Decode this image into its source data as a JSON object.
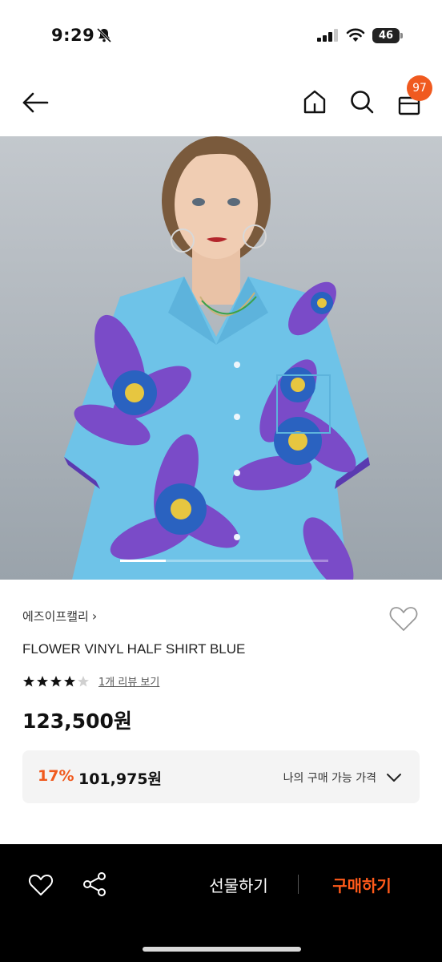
{
  "status_bar": {
    "time": "9:29",
    "battery": "46"
  },
  "header": {
    "cart_count": "97"
  },
  "product": {
    "brand": "에즈이프캘리",
    "name": "FLOWER VINYL HALF SHIRT BLUE",
    "rating": 4,
    "rating_max": 5,
    "review_link": "1개 리뷰 보기",
    "price": "123,500원",
    "image_progress": 0.22
  },
  "my_price": {
    "discount": "17%",
    "price": "101,975원",
    "label": "나의 구매 가능 가격"
  },
  "bottom_bar": {
    "gift_label": "선물하기",
    "buy_label": "구매하기"
  },
  "colors": {
    "accent": "#f05a1f",
    "buy": "#ff5a1a",
    "shirt": "#6ec3e8",
    "flower": "#7a4bc8"
  }
}
